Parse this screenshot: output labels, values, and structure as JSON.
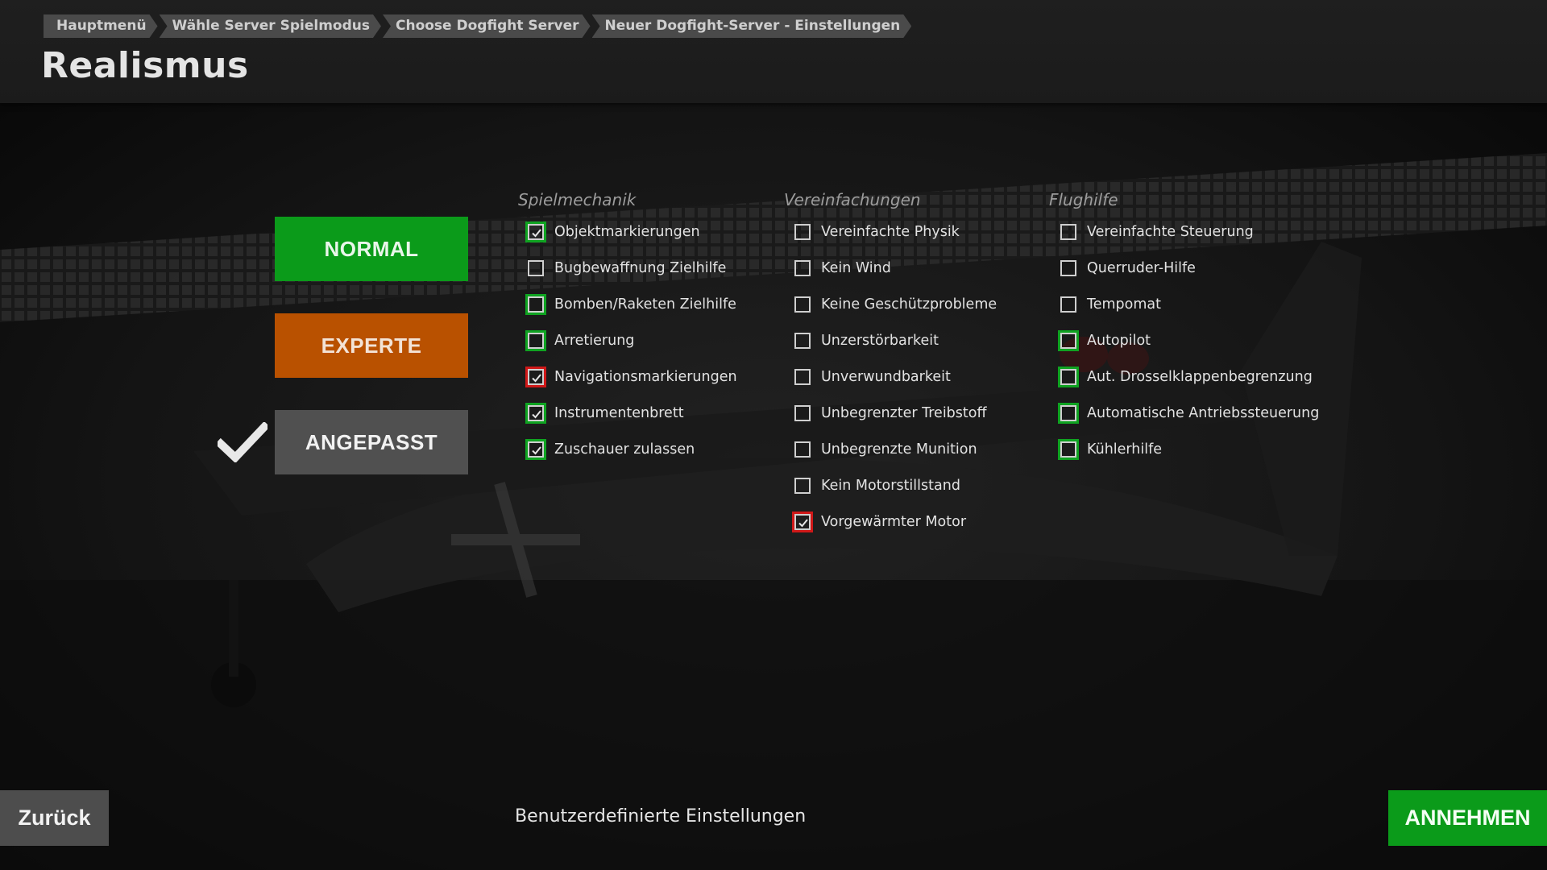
{
  "breadcrumb": [
    "Hauptmenü",
    "Wähle Server Spielmodus",
    "Choose Dogfight Server",
    "Neuer Dogfight-Server - Einstellungen"
  ],
  "page_title": "Realismus",
  "presets": {
    "normal": "NORMAL",
    "expert": "EXPERTE",
    "custom": "ANGEPASST",
    "selected": "custom"
  },
  "columns": [
    {
      "title": "Spielmechanik",
      "options": [
        {
          "label": "Objektmarkierungen",
          "checked": true,
          "highlight": "green"
        },
        {
          "label": "Bugbewaffnung Zielhilfe",
          "checked": false,
          "highlight": "none"
        },
        {
          "label": "Bomben/Raketen Zielhilfe",
          "checked": false,
          "highlight": "green"
        },
        {
          "label": "Arretierung",
          "checked": false,
          "highlight": "green"
        },
        {
          "label": "Navigationsmarkierungen",
          "checked": true,
          "highlight": "red"
        },
        {
          "label": "Instrumentenbrett",
          "checked": true,
          "highlight": "green"
        },
        {
          "label": "Zuschauer zulassen",
          "checked": true,
          "highlight": "green"
        }
      ]
    },
    {
      "title": "Vereinfachungen",
      "options": [
        {
          "label": "Vereinfachte Physik",
          "checked": false,
          "highlight": "none"
        },
        {
          "label": "Kein Wind",
          "checked": false,
          "highlight": "none"
        },
        {
          "label": "Keine Geschützprobleme",
          "checked": false,
          "highlight": "none"
        },
        {
          "label": "Unzerstörbarkeit",
          "checked": false,
          "highlight": "none"
        },
        {
          "label": "Unverwundbarkeit",
          "checked": false,
          "highlight": "none"
        },
        {
          "label": "Unbegrenzter Treibstoff",
          "checked": false,
          "highlight": "none"
        },
        {
          "label": "Unbegrenzte Munition",
          "checked": false,
          "highlight": "none"
        },
        {
          "label": "Kein Motorstillstand",
          "checked": false,
          "highlight": "none"
        },
        {
          "label": "Vorgewärmter Motor",
          "checked": true,
          "highlight": "red"
        }
      ]
    },
    {
      "title": "Flughilfe",
      "options": [
        {
          "label": "Vereinfachte Steuerung",
          "checked": false,
          "highlight": "none"
        },
        {
          "label": "Querruder-Hilfe",
          "checked": false,
          "highlight": "none"
        },
        {
          "label": "Tempomat",
          "checked": false,
          "highlight": "none"
        },
        {
          "label": "Autopilot",
          "checked": false,
          "highlight": "green"
        },
        {
          "label": "Aut. Drosselklappenbegrenzung",
          "checked": false,
          "highlight": "green"
        },
        {
          "label": "Automatische Antriebssteuerung",
          "checked": false,
          "highlight": "green"
        },
        {
          "label": "Kühlerhilfe",
          "checked": false,
          "highlight": "green"
        }
      ]
    }
  ],
  "footer": {
    "back_label": "Zurück",
    "status_text": "Benutzerdefinierte Einstellungen",
    "accept_label": "ANNEHMEN"
  },
  "colors": {
    "accent_green": "#0b9b1a",
    "accent_orange": "#b95100",
    "warning_red": "#d01818",
    "header_bg": "#1f1f1f"
  },
  "icons": {
    "preset_selected": "checkmark-icon",
    "option_checked": "check-icon"
  }
}
